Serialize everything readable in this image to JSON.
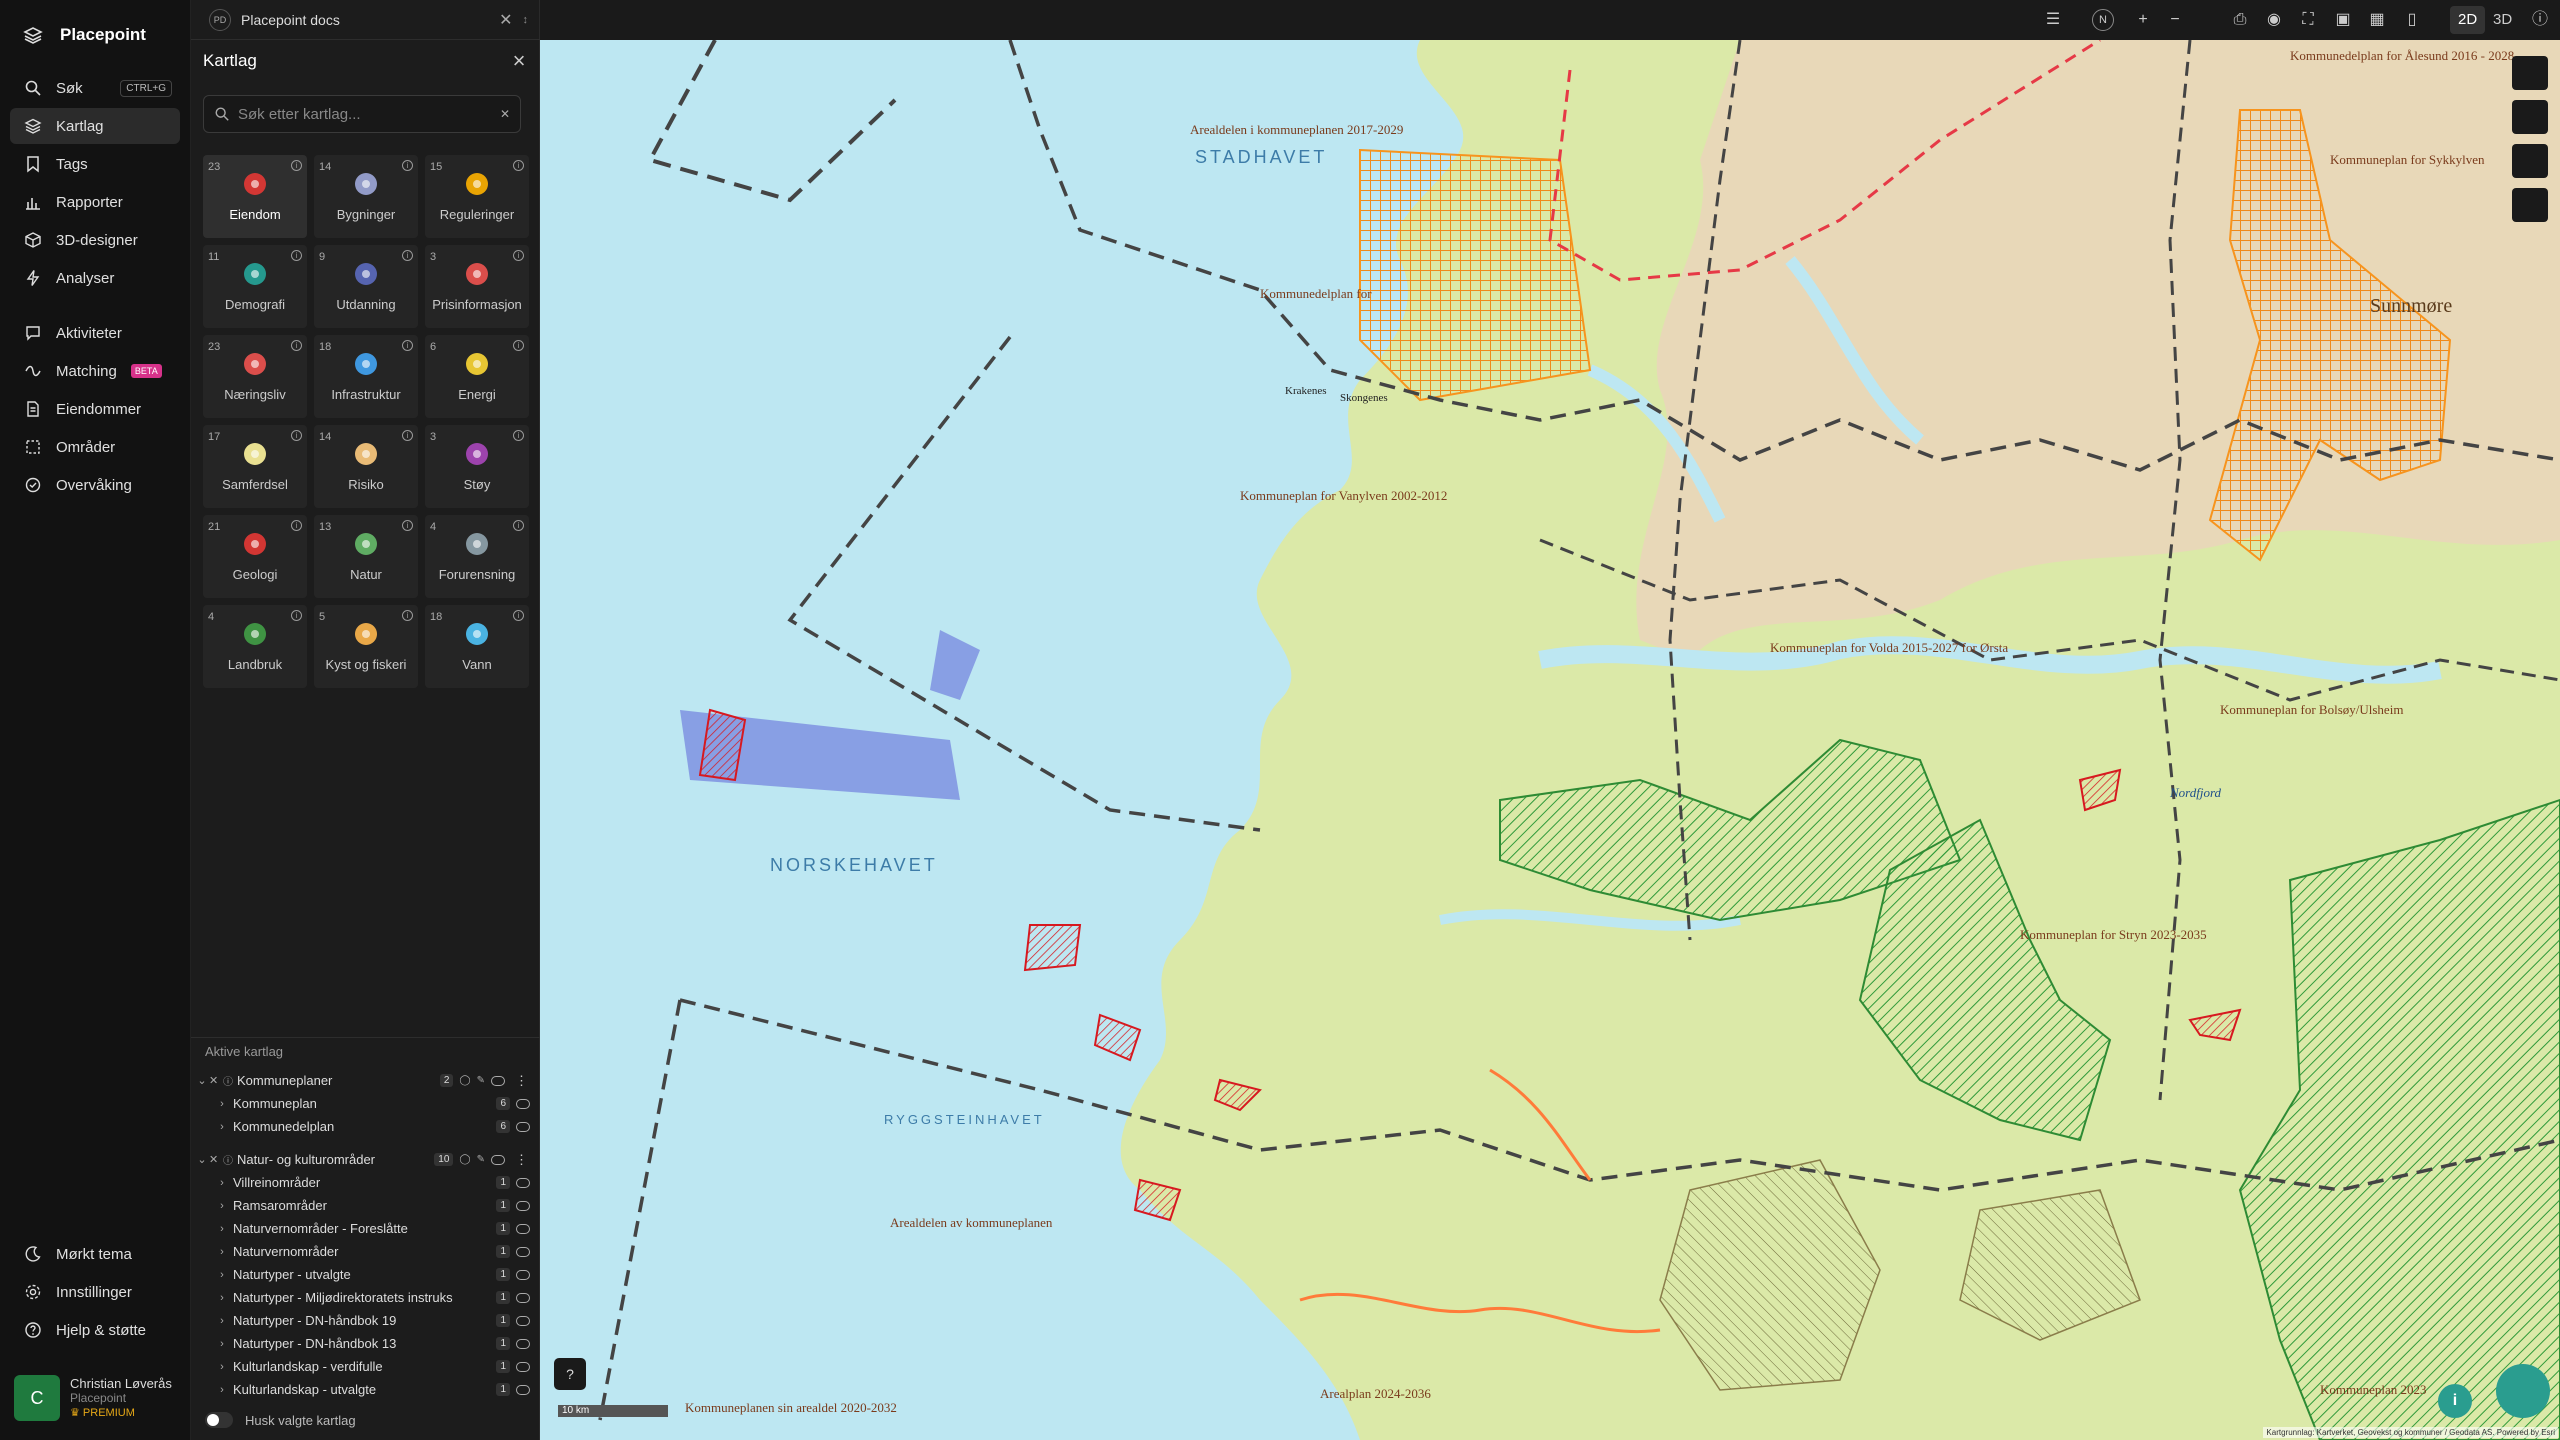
{
  "brand": {
    "title": "Placepoint"
  },
  "nav": {
    "items": [
      {
        "label": "Søk",
        "shortcut": "CTRL+G"
      },
      {
        "label": "Kartlag"
      },
      {
        "label": "Tags"
      },
      {
        "label": "Rapporter"
      },
      {
        "label": "3D-designer"
      },
      {
        "label": "Analyser"
      },
      {
        "label": "Aktiviteter"
      },
      {
        "label": "Matching",
        "badge": "BETA"
      },
      {
        "label": "Eiendommer"
      },
      {
        "label": "Områder"
      },
      {
        "label": "Overvåking"
      }
    ],
    "bottom": [
      {
        "label": "Mørkt tema"
      },
      {
        "label": "Innstillinger"
      },
      {
        "label": "Hjelp & støtte"
      }
    ],
    "user": {
      "initial": "C",
      "name": "Christian Løverås",
      "org": "Placepoint",
      "plan": "PREMIUM"
    }
  },
  "panel": {
    "tab": {
      "badge": "PD",
      "title": "Placepoint docs"
    },
    "title": "Kartlag",
    "search_placeholder": "Søk etter kartlag...",
    "tiles": [
      {
        "count": "23",
        "label": "Eiendom"
      },
      {
        "count": "14",
        "label": "Bygninger"
      },
      {
        "count": "15",
        "label": "Reguleringer"
      },
      {
        "count": "11",
        "label": "Demografi"
      },
      {
        "count": "9",
        "label": "Utdanning"
      },
      {
        "count": "3",
        "label": "Prisinformasjon"
      },
      {
        "count": "23",
        "label": "Næringsliv"
      },
      {
        "count": "18",
        "label": "Infrastruktur"
      },
      {
        "count": "6",
        "label": "Energi"
      },
      {
        "count": "17",
        "label": "Samferdsel"
      },
      {
        "count": "14",
        "label": "Risiko"
      },
      {
        "count": "3",
        "label": "Støy"
      },
      {
        "count": "21",
        "label": "Geologi"
      },
      {
        "count": "13",
        "label": "Natur"
      },
      {
        "count": "4",
        "label": "Forurensning"
      },
      {
        "count": "4",
        "label": "Landbruk"
      },
      {
        "count": "5",
        "label": "Kyst og fiskeri"
      },
      {
        "count": "18",
        "label": "Vann"
      }
    ],
    "active_header": "Aktive kartlag",
    "groups": [
      {
        "name": "Kommuneplaner",
        "count": "2",
        "layers": [
          {
            "name": "Kommuneplan",
            "count": "6"
          },
          {
            "name": "Kommunedelplan",
            "count": "6"
          }
        ]
      },
      {
        "name": "Natur- og kulturområder",
        "count": "10",
        "layers": [
          {
            "name": "Villreinområder",
            "count": "1"
          },
          {
            "name": "Ramsarområder",
            "count": "1"
          },
          {
            "name": "Naturvernområder - Foreslåtte",
            "count": "1"
          },
          {
            "name": "Naturvernområder",
            "count": "1"
          },
          {
            "name": "Naturtyper - utvalgte",
            "count": "1"
          },
          {
            "name": "Naturtyper - Miljødirektoratets instruks",
            "count": "1"
          },
          {
            "name": "Naturtyper - DN-håndbok 19",
            "count": "1"
          },
          {
            "name": "Naturtyper - DN-håndbok 13",
            "count": "1"
          },
          {
            "name": "Kulturlandskap - verdifulle",
            "count": "1"
          },
          {
            "name": "Kulturlandskap - utvalgte",
            "count": "1"
          }
        ]
      }
    ],
    "remember_label": "Husk valgte kartlag"
  },
  "topbar": {
    "view_2d": "2D",
    "view_3d": "3D",
    "compass": "N"
  },
  "map": {
    "sea_labels": [
      "STADHAVET",
      "NORSKEHAVET",
      "RYGGSTEINHAVET"
    ],
    "plan_labels": [
      "Arealdelen i kommuneplanen 2017-2029",
      "Kommunedelplan for Ålesund 2016 - 2028",
      "Kommuneplan for Sykkylven",
      "Kommunedelplan for",
      "Kommuneplan for Vanylven 2002-2012",
      "Kommuneplan for Volda 2015-2027 for Ørsta",
      "Kommuneplan for Bolsøy/Ulsheim",
      "Kommuneplan for Stryn 2023-2035",
      "Arealdelen av kommuneplanen",
      "Kommuneplanen sin arealdel 2020-2032",
      "Arealplan 2024-2036",
      "Kommuneplan 2023"
    ],
    "place_labels": [
      "Sunnmøre",
      "Nordfjord",
      "Krakenes",
      "Skongenes"
    ],
    "scale": "10 km",
    "attribution": "Kartgrunnlag: Kartverket, Geovekst og kommuner / Geodata AS. Powered by Esri",
    "colors": {
      "land": "#dbe9a8",
      "sea": "#bde7f2",
      "protected": "#39b54a",
      "plan": "#f7941d",
      "nature": "#d71920",
      "border": "#444444"
    }
  }
}
